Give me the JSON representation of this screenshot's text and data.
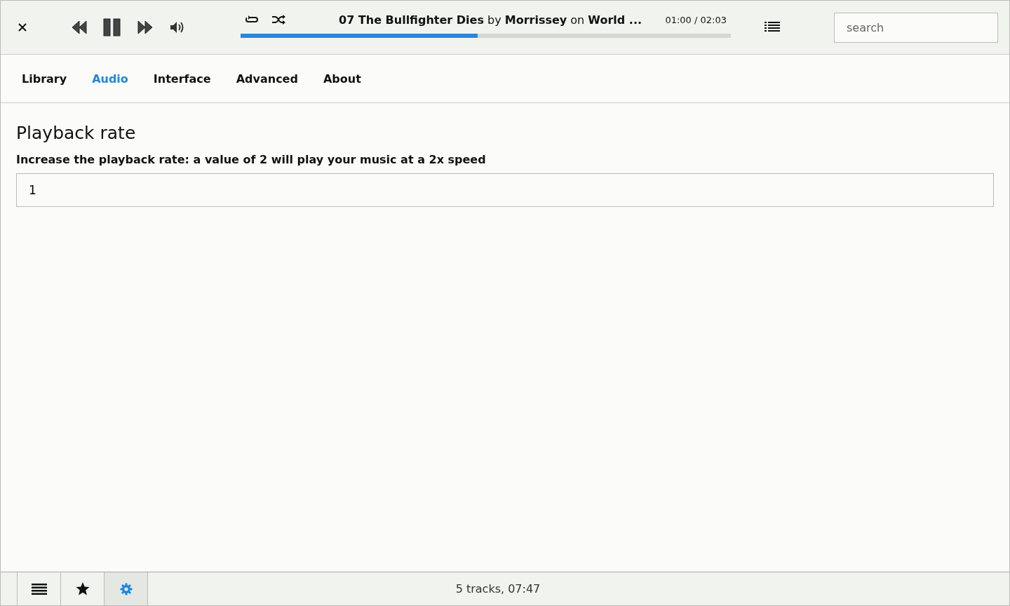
{
  "player": {
    "track_info": "**07 The Bullfighter Dies** by **Morrissey** on **World ...**",
    "time": "01:00 / 02:03",
    "progress": {
      "level": 0.484
    },
    "search": {
      "placeholder": "search"
    }
  },
  "tabs": [
    {
      "label": "Library",
      "selected": false
    },
    {
      "label": "Audio",
      "selected": true
    },
    {
      "label": "Interface",
      "selected": false
    },
    {
      "label": "Advanced",
      "selected": false
    },
    {
      "label": "About",
      "selected": false
    }
  ],
  "section": {
    "title": "Playback rate",
    "description": "Increase the playback rate: a value of 2 will play your music at a 2x speed",
    "value": "1"
  },
  "footer": {
    "views": [
      {
        "kind": "list",
        "selected": false
      },
      {
        "kind": "favorites",
        "selected": false
      },
      {
        "kind": "settings",
        "selected": true
      }
    ],
    "status": "5 tracks, 07:47"
  }
}
